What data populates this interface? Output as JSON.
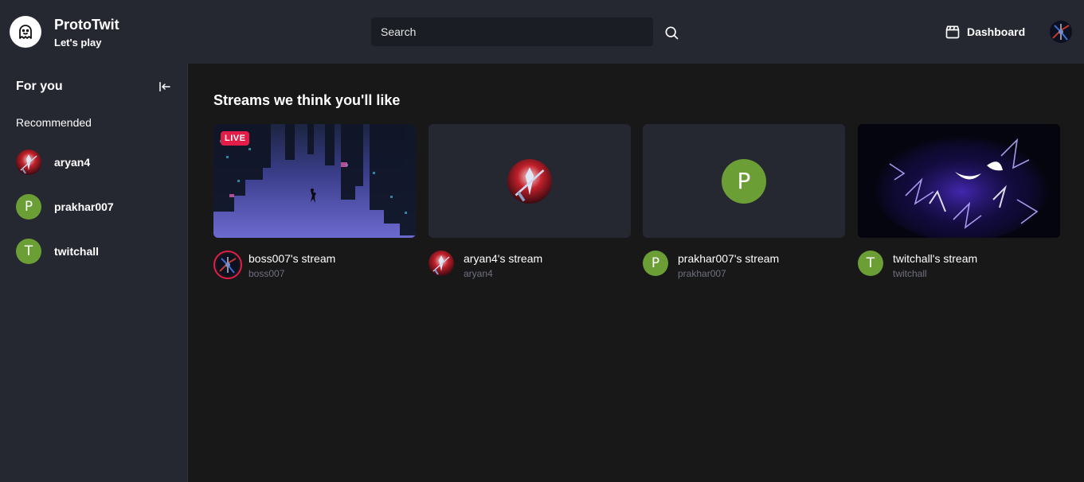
{
  "header": {
    "app_title": "ProtoTwit",
    "app_subtitle": "Let's play",
    "search_placeholder": "Search",
    "dashboard_label": "Dashboard",
    "logo_icon": "ghost-icon",
    "search_icon": "search-icon",
    "dashboard_icon": "clapperboard-icon"
  },
  "sidebar": {
    "title": "For you",
    "collapse_icon": "arrow-left-to-line-icon",
    "section_label": "Recommended",
    "items": [
      {
        "label": "aryan4",
        "avatar": "image"
      },
      {
        "label": "prakhar007",
        "avatar": "P"
      },
      {
        "label": "twitchall",
        "avatar": "T"
      }
    ]
  },
  "main": {
    "title": "Streams we think you'll like",
    "streams": [
      {
        "title": "boss007's stream",
        "username": "boss007",
        "live": true,
        "live_label": "LIVE",
        "avatar": "image"
      },
      {
        "title": "aryan4's stream",
        "username": "aryan4",
        "live": false,
        "avatar": "image"
      },
      {
        "title": "prakhar007's stream",
        "username": "prakhar007",
        "live": false,
        "avatar": "P",
        "thumb_letter": "P"
      },
      {
        "title": "twitchall's stream",
        "username": "twitchall",
        "live": false,
        "avatar": "T"
      }
    ]
  },
  "colors": {
    "header_bg": "#252731",
    "page_bg": "#181819",
    "live_red": "#e11d48",
    "avatar_green": "#6b9e35",
    "muted_text": "#6e7180"
  }
}
